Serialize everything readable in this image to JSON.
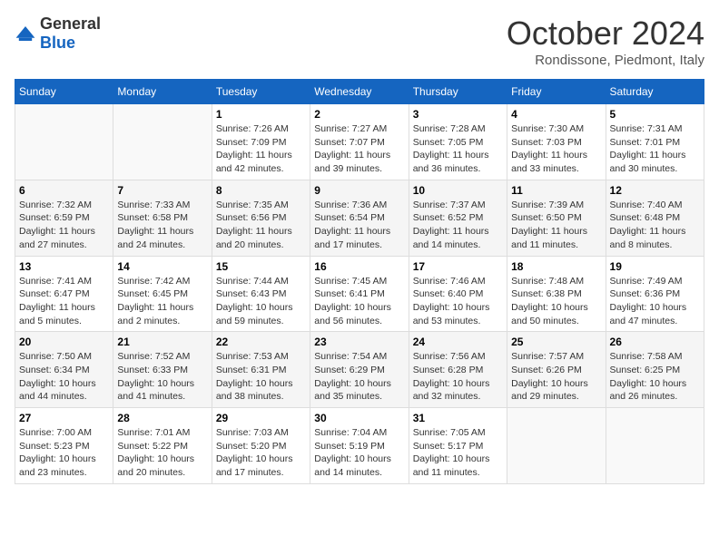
{
  "header": {
    "logo_general": "General",
    "logo_blue": "Blue",
    "month": "October 2024",
    "location": "Rondissone, Piedmont, Italy"
  },
  "days_of_week": [
    "Sunday",
    "Monday",
    "Tuesday",
    "Wednesday",
    "Thursday",
    "Friday",
    "Saturday"
  ],
  "weeks": [
    [
      {
        "day": "",
        "info": ""
      },
      {
        "day": "",
        "info": ""
      },
      {
        "day": "1",
        "sunrise": "Sunrise: 7:26 AM",
        "sunset": "Sunset: 7:09 PM",
        "daylight": "Daylight: 11 hours and 42 minutes."
      },
      {
        "day": "2",
        "sunrise": "Sunrise: 7:27 AM",
        "sunset": "Sunset: 7:07 PM",
        "daylight": "Daylight: 11 hours and 39 minutes."
      },
      {
        "day": "3",
        "sunrise": "Sunrise: 7:28 AM",
        "sunset": "Sunset: 7:05 PM",
        "daylight": "Daylight: 11 hours and 36 minutes."
      },
      {
        "day": "4",
        "sunrise": "Sunrise: 7:30 AM",
        "sunset": "Sunset: 7:03 PM",
        "daylight": "Daylight: 11 hours and 33 minutes."
      },
      {
        "day": "5",
        "sunrise": "Sunrise: 7:31 AM",
        "sunset": "Sunset: 7:01 PM",
        "daylight": "Daylight: 11 hours and 30 minutes."
      }
    ],
    [
      {
        "day": "6",
        "sunrise": "Sunrise: 7:32 AM",
        "sunset": "Sunset: 6:59 PM",
        "daylight": "Daylight: 11 hours and 27 minutes."
      },
      {
        "day": "7",
        "sunrise": "Sunrise: 7:33 AM",
        "sunset": "Sunset: 6:58 PM",
        "daylight": "Daylight: 11 hours and 24 minutes."
      },
      {
        "day": "8",
        "sunrise": "Sunrise: 7:35 AM",
        "sunset": "Sunset: 6:56 PM",
        "daylight": "Daylight: 11 hours and 20 minutes."
      },
      {
        "day": "9",
        "sunrise": "Sunrise: 7:36 AM",
        "sunset": "Sunset: 6:54 PM",
        "daylight": "Daylight: 11 hours and 17 minutes."
      },
      {
        "day": "10",
        "sunrise": "Sunrise: 7:37 AM",
        "sunset": "Sunset: 6:52 PM",
        "daylight": "Daylight: 11 hours and 14 minutes."
      },
      {
        "day": "11",
        "sunrise": "Sunrise: 7:39 AM",
        "sunset": "Sunset: 6:50 PM",
        "daylight": "Daylight: 11 hours and 11 minutes."
      },
      {
        "day": "12",
        "sunrise": "Sunrise: 7:40 AM",
        "sunset": "Sunset: 6:48 PM",
        "daylight": "Daylight: 11 hours and 8 minutes."
      }
    ],
    [
      {
        "day": "13",
        "sunrise": "Sunrise: 7:41 AM",
        "sunset": "Sunset: 6:47 PM",
        "daylight": "Daylight: 11 hours and 5 minutes."
      },
      {
        "day": "14",
        "sunrise": "Sunrise: 7:42 AM",
        "sunset": "Sunset: 6:45 PM",
        "daylight": "Daylight: 11 hours and 2 minutes."
      },
      {
        "day": "15",
        "sunrise": "Sunrise: 7:44 AM",
        "sunset": "Sunset: 6:43 PM",
        "daylight": "Daylight: 10 hours and 59 minutes."
      },
      {
        "day": "16",
        "sunrise": "Sunrise: 7:45 AM",
        "sunset": "Sunset: 6:41 PM",
        "daylight": "Daylight: 10 hours and 56 minutes."
      },
      {
        "day": "17",
        "sunrise": "Sunrise: 7:46 AM",
        "sunset": "Sunset: 6:40 PM",
        "daylight": "Daylight: 10 hours and 53 minutes."
      },
      {
        "day": "18",
        "sunrise": "Sunrise: 7:48 AM",
        "sunset": "Sunset: 6:38 PM",
        "daylight": "Daylight: 10 hours and 50 minutes."
      },
      {
        "day": "19",
        "sunrise": "Sunrise: 7:49 AM",
        "sunset": "Sunset: 6:36 PM",
        "daylight": "Daylight: 10 hours and 47 minutes."
      }
    ],
    [
      {
        "day": "20",
        "sunrise": "Sunrise: 7:50 AM",
        "sunset": "Sunset: 6:34 PM",
        "daylight": "Daylight: 10 hours and 44 minutes."
      },
      {
        "day": "21",
        "sunrise": "Sunrise: 7:52 AM",
        "sunset": "Sunset: 6:33 PM",
        "daylight": "Daylight: 10 hours and 41 minutes."
      },
      {
        "day": "22",
        "sunrise": "Sunrise: 7:53 AM",
        "sunset": "Sunset: 6:31 PM",
        "daylight": "Daylight: 10 hours and 38 minutes."
      },
      {
        "day": "23",
        "sunrise": "Sunrise: 7:54 AM",
        "sunset": "Sunset: 6:29 PM",
        "daylight": "Daylight: 10 hours and 35 minutes."
      },
      {
        "day": "24",
        "sunrise": "Sunrise: 7:56 AM",
        "sunset": "Sunset: 6:28 PM",
        "daylight": "Daylight: 10 hours and 32 minutes."
      },
      {
        "day": "25",
        "sunrise": "Sunrise: 7:57 AM",
        "sunset": "Sunset: 6:26 PM",
        "daylight": "Daylight: 10 hours and 29 minutes."
      },
      {
        "day": "26",
        "sunrise": "Sunrise: 7:58 AM",
        "sunset": "Sunset: 6:25 PM",
        "daylight": "Daylight: 10 hours and 26 minutes."
      }
    ],
    [
      {
        "day": "27",
        "sunrise": "Sunrise: 7:00 AM",
        "sunset": "Sunset: 5:23 PM",
        "daylight": "Daylight: 10 hours and 23 minutes."
      },
      {
        "day": "28",
        "sunrise": "Sunrise: 7:01 AM",
        "sunset": "Sunset: 5:22 PM",
        "daylight": "Daylight: 10 hours and 20 minutes."
      },
      {
        "day": "29",
        "sunrise": "Sunrise: 7:03 AM",
        "sunset": "Sunset: 5:20 PM",
        "daylight": "Daylight: 10 hours and 17 minutes."
      },
      {
        "day": "30",
        "sunrise": "Sunrise: 7:04 AM",
        "sunset": "Sunset: 5:19 PM",
        "daylight": "Daylight: 10 hours and 14 minutes."
      },
      {
        "day": "31",
        "sunrise": "Sunrise: 7:05 AM",
        "sunset": "Sunset: 5:17 PM",
        "daylight": "Daylight: 10 hours and 11 minutes."
      },
      {
        "day": "",
        "info": ""
      },
      {
        "day": "",
        "info": ""
      }
    ]
  ]
}
